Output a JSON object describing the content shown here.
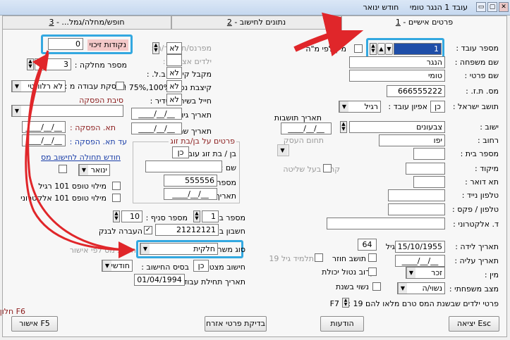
{
  "window": {
    "title": "עובד 1 הנגר טומי",
    "subtitle": "חודש ינואר"
  },
  "tabs": [
    {
      "num": "1",
      "label": "פרטים אישיים -"
    },
    {
      "num": "2",
      "label": "נתונים לחישוב -"
    },
    {
      "num": "3",
      "label": "חופש/מחלה/גמל... -"
    }
  ],
  "personal": {
    "employee_no_label": "מספר עובד :",
    "employee_no": "1",
    "sort_by_name_label": "מיין לפי מ\"ה",
    "last_name_label": "שם משפחה :",
    "last_name": "הנגר",
    "first_name_label": "שם פרטי :",
    "first_name": "טומי",
    "id_label": "מס. ת.ז. :",
    "id": "666555222",
    "resident_label": "תושב ישראל :",
    "resident": "כן",
    "emp_type_label": "אפיון עובד :",
    "emp_type": "רגיל",
    "settlement_date_label": "תאריך תושבות",
    "settlement_date": "__/__/____",
    "city_label": "ישוב :",
    "city": "צבעונים",
    "area_label": "תחום העסק",
    "street_label": "רחוב :",
    "street": "יפו",
    "house_label": "מספר בית :",
    "relative_label": "קרוב בעל שליטה",
    "zip_label": "מיקוד :",
    "pobox_label": "תא דואר :",
    "mobile_label": "טלפון נייד :",
    "phone_label": "טלפון / פקס :",
    "email_label": "ד. אלקטרוני :",
    "birth_label": "תאריך לידה :",
    "birth": "15/10/1955",
    "age_label": "גיל",
    "age": "64",
    "aliya_label": "תאריך עליה :",
    "aliya": "__/__/____",
    "returning_label": "תושב חוזר",
    "student_label": "תלמיד גיל 19",
    "gender_label": "מין :",
    "gender": "זכר",
    "disabled_label": "קרוב נטול יכולת",
    "marital_label": "מצב משפחתי :",
    "marital": "נשוי/ה",
    "spouse_works_label": "נשוי בשנת",
    "kids_label": "פרטי ילדים שבשנת המס טרם מלאו להם 19 :",
    "kids_key": "F7"
  },
  "calc": {
    "points_label": "נקודות זיכוי",
    "points": "0",
    "kids_pts_label": "מפרנס/ת לילד/ה :",
    "kids_pts": "לא",
    "child_with_label": "ילדים אצלו/ה :",
    "allowance_label": "מקבל קיצבת ב.ל. :",
    "allowance": "לא",
    "disab_label": "קיצבת נכות 100%,75% :",
    "disab": "לא",
    "soldier_label": "חייל בשירות סדיר :",
    "soldier": "לא",
    "army_start_label": "תאריך גיוס בצה\"ל :",
    "army_start": "__/__/____",
    "army_end_label": "תאריך שחרור מצה\"ל :",
    "army_end": "__/__/____",
    "dept_label": "מספר מחלקה :",
    "dept": "3",
    "stop_work_label": "הפסקת עבודה מ :",
    "stop_work": "לא רלוונטי",
    "stop_reason_label": "סיבת הפסקה",
    "stop_date_label": "תא. הפסקה :",
    "stop_date": "__/__/____",
    "until_label": "עד תא. הפסקה :",
    "until": "__/__/____",
    "calc_month_label": "חודש תחולה לחישוב מס",
    "calc_month": "ינואר",
    "form101_label": "מילוי טופס 101 רגיל",
    "form101e_label": "מילוי טופס 101 אלקטרוני",
    "spouse_header": "פרטים על בן/בת זוג",
    "spouse_works_q": "בן / בת זוג עובד ?",
    "spouse_works": "כן",
    "spouse_name_label": "שם :",
    "spouse_id_label": "מספר ת.ז. :",
    "spouse_id": "555556",
    "spouse_birth_label": "תאריך לידה :",
    "spouse_birth": "__/__/____",
    "bank_label": "מספר בנק :",
    "bank": "1",
    "branch_label": "מספר סניף :",
    "branch": "10",
    "account_label": "חשבון בנק :",
    "account": "21212121",
    "transfer_label": "העברה לבנק",
    "job_label": "סוג משרה :",
    "job": "חלקית",
    "by_approval_label": "חישוב מס לפי אישור",
    "cumul_label": "חישוב מצטבר :",
    "cumul": "כן",
    "basis_label": "בסיס החישוב :",
    "basis": "חודשי",
    "start_label": "תאריך תחילת עבודה :",
    "start": "01/04/1994"
  },
  "footer": {
    "exit": "יציאה Esc",
    "messages": "הודעות",
    "help": "בדיקת פרטי אזרח",
    "ok": "אישור F5",
    "f6": "F6 חלון"
  },
  "colors": {
    "highlight": "#33a8e0",
    "arrow": "#e0262a"
  }
}
